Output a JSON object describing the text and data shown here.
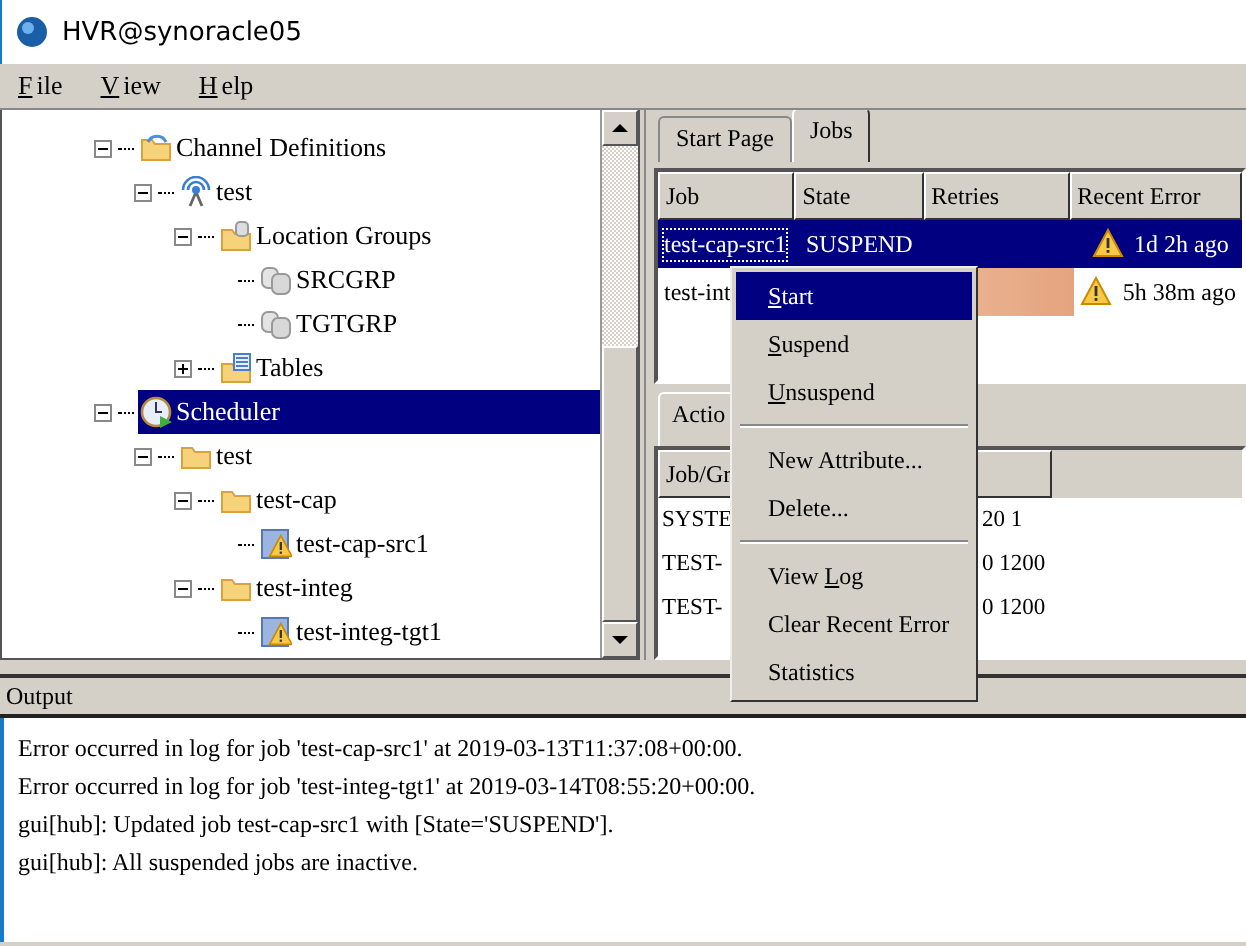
{
  "window": {
    "title": "HVR@synoracle05"
  },
  "menu_bar": [
    {
      "parts": [
        {
          "text": "F",
          "underlined": true
        },
        {
          "text": "ile",
          "underlined": false
        }
      ]
    },
    {
      "parts": [
        {
          "text": "V",
          "underlined": true
        },
        {
          "text": "iew",
          "underlined": false
        }
      ]
    },
    {
      "parts": [
        {
          "text": "H",
          "underlined": true
        },
        {
          "text": "elp",
          "underlined": false
        }
      ]
    }
  ],
  "tree": [
    {
      "label": "Channel Definitions",
      "kind": "channels",
      "expanded": true,
      "selected": false,
      "children": [
        {
          "label": "test",
          "kind": "channel",
          "expanded": true,
          "selected": false,
          "children": [
            {
              "label": "Location Groups",
              "kind": "groups",
              "expanded": true,
              "selected": false,
              "children": [
                {
                  "label": "SRCGRP",
                  "kind": "group",
                  "selected": false
                },
                {
                  "label": "TGTGRP",
                  "kind": "group",
                  "selected": false
                }
              ]
            },
            {
              "label": "Tables",
              "kind": "tables",
              "expanded": false,
              "selected": false
            }
          ]
        }
      ]
    },
    {
      "label": "Scheduler",
      "kind": "scheduler",
      "expanded": true,
      "selected": true,
      "children": [
        {
          "label": "test",
          "kind": "folder",
          "expanded": true,
          "selected": false,
          "children": [
            {
              "label": "test-cap",
              "kind": "folder",
              "expanded": true,
              "selected": false,
              "children": [
                {
                  "label": "test-cap-src1",
                  "kind": "job",
                  "selected": false
                }
              ]
            },
            {
              "label": "test-integ",
              "kind": "folder",
              "expanded": true,
              "selected": false,
              "children": [
                {
                  "label": "test-integ-tgt1",
                  "kind": "job",
                  "selected": false
                }
              ]
            }
          ]
        }
      ]
    }
  ],
  "jobs_tabs": [
    {
      "label": "Start Page",
      "selected": false
    },
    {
      "label": "Jobs",
      "selected": true
    }
  ],
  "jobs_table": {
    "columns": [
      "Job",
      "State",
      "Retries",
      "Recent Error"
    ],
    "rows": [
      {
        "job": "test-cap-src1",
        "state": "SUSPEND",
        "recent_error": "1d 2h ago",
        "selected": true
      },
      {
        "job": "test-int",
        "recent_error": "5h 38m ago",
        "selected": false,
        "color": "#e4a47e"
      }
    ]
  },
  "actions_tab": {
    "label": "Actio"
  },
  "actions_table": {
    "columns": [
      "Job/Gr"
    ],
    "rows": [
      {
        "column_1": "SYSTE",
        "column_2": "20 1"
      },
      {
        "column_1": "TEST-",
        "column_2": "0 1200"
      },
      {
        "column_1": "TEST-",
        "column_2": "0 1200"
      }
    ]
  },
  "context_menu": [
    {
      "kind": "item",
      "parts": [
        {
          "text": "S",
          "underlined": true
        },
        {
          "text": "tart",
          "underlined": false
        }
      ],
      "selected": true
    },
    {
      "kind": "item",
      "parts": [
        {
          "text": "S",
          "underlined": true
        },
        {
          "text": "uspend",
          "underlined": false
        }
      ],
      "selected": false
    },
    {
      "kind": "item",
      "parts": [
        {
          "text": "U",
          "underlined": true
        },
        {
          "text": "nsuspend",
          "underlined": false
        }
      ],
      "selected": false
    },
    {
      "kind": "separator"
    },
    {
      "kind": "item",
      "parts": [
        {
          "text": "New Attribute...",
          "underlined": false
        }
      ],
      "selected": false
    },
    {
      "kind": "item",
      "parts": [
        {
          "text": "Delete...",
          "underlined": false
        }
      ],
      "selected": false
    },
    {
      "kind": "separator"
    },
    {
      "kind": "item",
      "parts": [
        {
          "text": "View ",
          "underlined": false
        },
        {
          "text": "L",
          "underlined": true
        },
        {
          "text": "og",
          "underlined": false
        }
      ],
      "selected": false
    },
    {
      "kind": "item",
      "parts": [
        {
          "text": "Clear Recent Error",
          "underlined": false
        }
      ],
      "selected": false
    },
    {
      "kind": "item",
      "parts": [
        {
          "text": "Statistics",
          "underlined": false
        }
      ],
      "selected": false
    }
  ],
  "output": {
    "title": "Output",
    "lines": [
      "Error occurred in log for job 'test-cap-src1' at 2019-03-13T11:37:08+00:00.",
      "Error occurred in log for job 'test-integ-tgt1' at 2019-03-14T08:55:20+00:00.",
      "gui[hub]: Updated job test-cap-src1  with [State='SUSPEND'].",
      "gui[hub]: All suspended jobs are inactive."
    ]
  }
}
